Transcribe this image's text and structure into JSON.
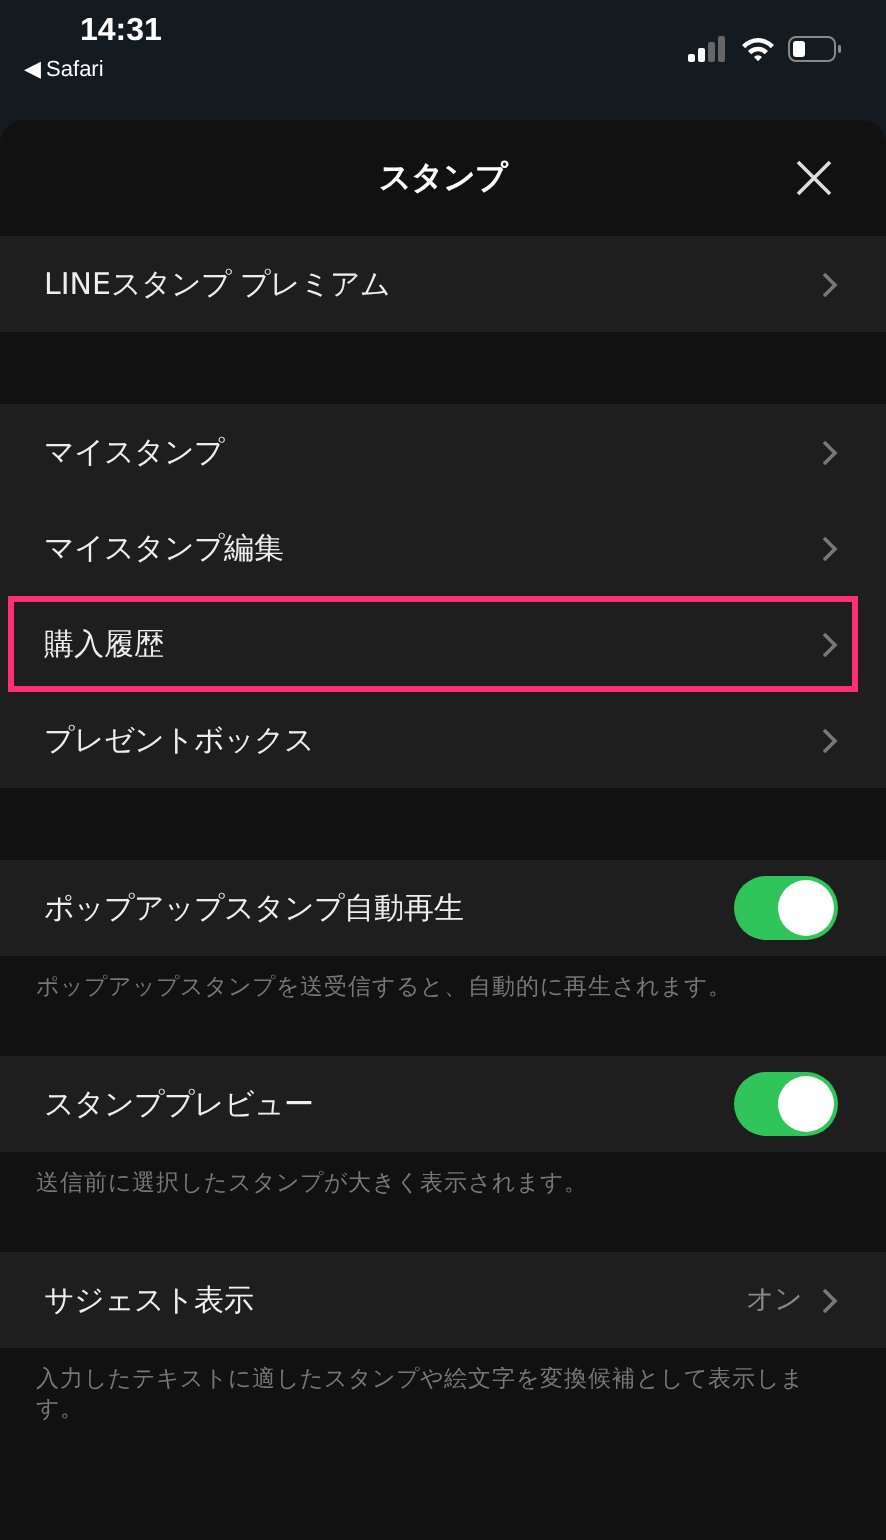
{
  "status_bar": {
    "time": "14:31",
    "back_app": "◀ Safari"
  },
  "header": {
    "title": "スタンプ"
  },
  "sections": [
    {
      "items": [
        {
          "kind": "link",
          "label": "LINEスタンプ プレミアム",
          "highlighted": false
        }
      ]
    },
    {
      "items": [
        {
          "kind": "link",
          "label": "マイスタンプ",
          "highlighted": false
        },
        {
          "kind": "link",
          "label": "マイスタンプ編集",
          "highlighted": false
        },
        {
          "kind": "link",
          "label": "購入履歴",
          "highlighted": true
        },
        {
          "kind": "link",
          "label": "プレゼントボックス",
          "highlighted": false
        }
      ]
    },
    {
      "items": [
        {
          "kind": "toggle",
          "label": "ポップアップスタンプ自動再生",
          "on": true
        }
      ],
      "note": "ポップアップスタンプを送受信すると、自動的に再生されます。"
    },
    {
      "items": [
        {
          "kind": "toggle",
          "label": "スタンププレビュー",
          "on": true
        }
      ],
      "note": "送信前に選択したスタンプが大きく表示されます。"
    },
    {
      "items": [
        {
          "kind": "value",
          "label": "サジェスト表示",
          "value": "オン"
        }
      ],
      "note": "入力したテキストに適したスタンプや絵文字を変換候補として表示します。"
    }
  ]
}
